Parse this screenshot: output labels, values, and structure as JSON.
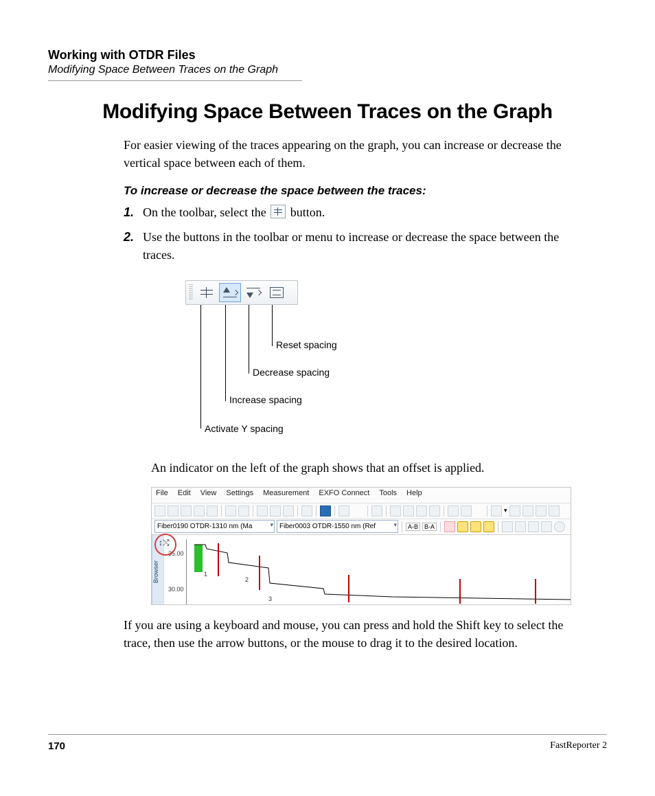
{
  "header": {
    "chapter": "Working with OTDR Files",
    "section": "Modifying Space Between Traces on the Graph"
  },
  "title": "Modifying Space Between Traces on the Graph",
  "intro": "For easier viewing of the traces appearing on the graph, you can increase or decrease the vertical space between each of them.",
  "procedure_heading": "To increase or decrease the space between the traces:",
  "steps": {
    "s1a": "On the toolbar, select the ",
    "s1b": " button.",
    "s2": "Use the buttons in the toolbar or menu to increase or decrease the space between the traces."
  },
  "toolbar_callouts": {
    "activate": "Activate Y spacing",
    "increase": "Increase spacing",
    "decrease": "Decrease spacing",
    "reset": "Reset spacing"
  },
  "after_diagram": "An indicator on the left of the graph shows that an offset is applied.",
  "screenshot": {
    "menus": [
      "File",
      "Edit",
      "View",
      "Settings",
      "Measurement",
      "EXFO Connect",
      "Tools",
      "Help"
    ],
    "combo1": "Fiber0190 OTDR-1310 nm (Ma",
    "combo2": "Fiber0003 OTDR-1550 nm (Ref",
    "ab": "A-B",
    "ba": "B-A",
    "browser_tab": "Browser",
    "yticks": {
      "t1": "35.00",
      "t2": "30.00"
    },
    "event_labels": {
      "e1": "1",
      "e2": "2",
      "e3": "3"
    }
  },
  "closing": "If you are using a keyboard and mouse, you can press and hold the Shift key to select the trace, then use the arrow buttons, or the mouse to drag it to the desired location.",
  "footer": {
    "page": "170",
    "product": "FastReporter 2"
  }
}
